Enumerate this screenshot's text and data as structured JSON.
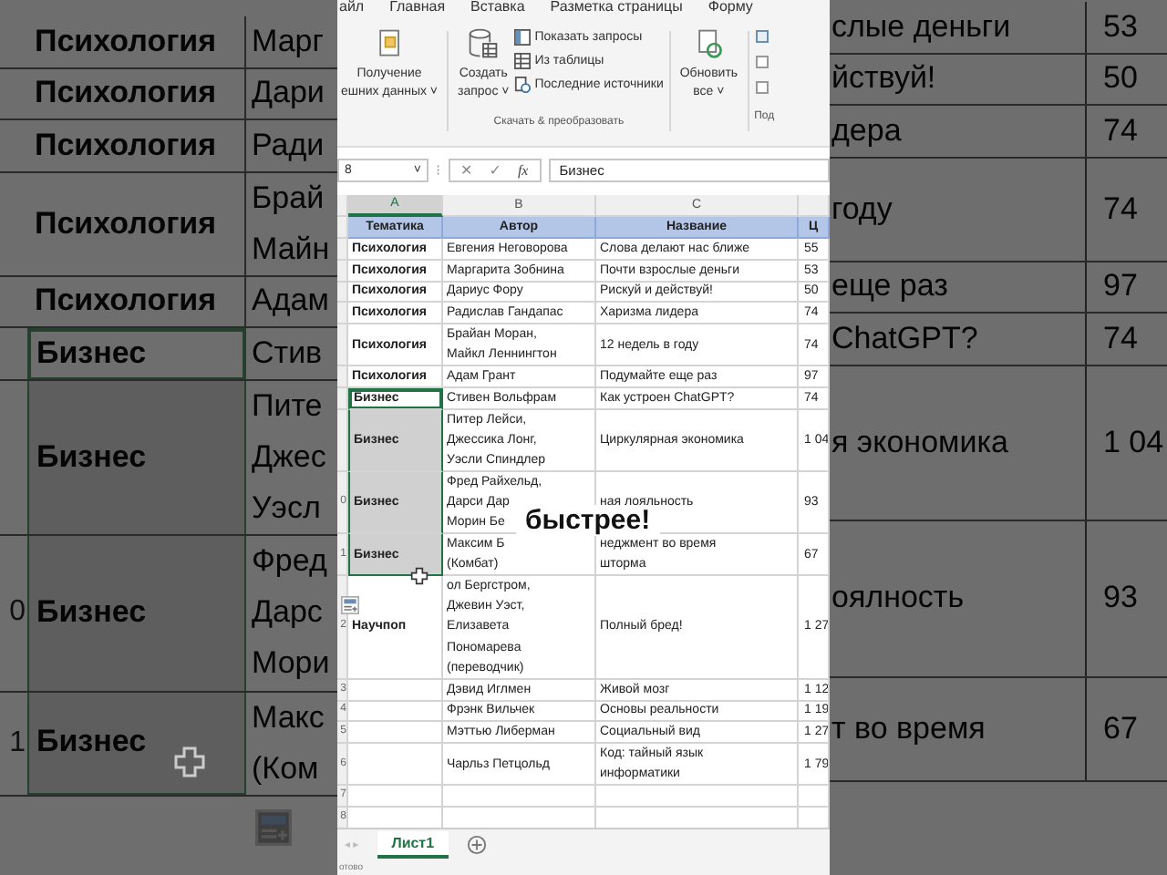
{
  "background": {
    "rows": [
      {
        "topic": "Психология",
        "author": [
          "Марг"
        ],
        "title": [
          "слые деньги"
        ],
        "price": "53",
        "selected": false,
        "active": false
      },
      {
        "topic": "Психология",
        "author": [
          "Дари"
        ],
        "title": [
          "йствуй!"
        ],
        "price": "50",
        "selected": false,
        "active": false
      },
      {
        "topic": "Психология",
        "author": [
          "Ради"
        ],
        "title": [
          "дера"
        ],
        "price": "74",
        "selected": false,
        "active": false
      },
      {
        "topic": "Психология",
        "author": [
          "Брай",
          "Майн"
        ],
        "title": [
          "году"
        ],
        "price": "74",
        "selected": false,
        "active": false
      },
      {
        "topic": "Психология",
        "author": [
          "Адам"
        ],
        "title": [
          "еще раз"
        ],
        "price": "97",
        "selected": false,
        "active": false
      },
      {
        "topic": "Бизнес",
        "author": [
          "Стив"
        ],
        "title": [
          "ChatGPT?"
        ],
        "price": "74",
        "selected": true,
        "active": true
      },
      {
        "topic": "Бизнес",
        "author": [
          "Пите",
          "Джес",
          "Уэсл"
        ],
        "title": [
          "я экономика"
        ],
        "price": "1 04",
        "selected": true,
        "active": false
      },
      {
        "number": "0",
        "topic": "Бизнес",
        "author": [
          "Фред",
          "Дарс",
          "Мори"
        ],
        "title": [
          "оялность"
        ],
        "price": "93",
        "selected": true,
        "active": false
      },
      {
        "number": "1",
        "topic": "Бизнес",
        "author": [
          "Макс",
          "(Ком"
        ],
        "title": [
          "т во время"
        ],
        "price": "67",
        "selected": true,
        "active": false
      }
    ]
  },
  "ribbon": {
    "tabs": [
      "айл",
      "Главная",
      "Вставка",
      "Разметка страницы",
      "Форму"
    ],
    "get_data": [
      "Получение",
      "ешних данных ˅"
    ],
    "create_query": [
      "Создать",
      "запрос ˅"
    ],
    "query_items": [
      "Показать запросы",
      "Из таблицы",
      "Последние источники"
    ],
    "group_label": "Скачать & преобразовать",
    "refresh": [
      "Обновить",
      "все ˅"
    ],
    "next_group_label": "Под"
  },
  "formula_bar": {
    "name_box": "8",
    "name_box_caret": "˅",
    "handle": "⁝",
    "buttons": [
      "✕",
      "✓",
      "fx"
    ],
    "value": "Бизнес"
  },
  "sheet": {
    "column_letters": [
      {
        "label": "A",
        "selected": true
      },
      {
        "label": "B",
        "selected": false
      },
      {
        "label": "C",
        "selected": false
      }
    ],
    "headers": [
      "Тематика",
      "Автор",
      "Название",
      "Ц"
    ],
    "rows": [
      {
        "topic": "Психология",
        "author": [
          "Евгения Неговорова"
        ],
        "title": [
          "Слова делают нас ближе"
        ],
        "price": "55",
        "selected": false,
        "active": false
      },
      {
        "topic": "Психология",
        "author": [
          "Маргарита Зобнина"
        ],
        "title": [
          "Почти взрослые деньги"
        ],
        "price": "53",
        "selected": false,
        "active": false
      },
      {
        "topic": "Психология",
        "author": [
          "Дариус Фору"
        ],
        "title": [
          "Рискуй и действуй!"
        ],
        "price": "50",
        "selected": false,
        "active": false
      },
      {
        "topic": "Психология",
        "author": [
          "Радислав Гандапас"
        ],
        "title": [
          "Харизма лидера"
        ],
        "price": "74",
        "selected": false,
        "active": false
      },
      {
        "topic": "Психология",
        "author": [
          "Брайан Моран,",
          "Майкл Леннингтон"
        ],
        "title": [
          "12 недель в году"
        ],
        "price": "74",
        "selected": false,
        "active": false
      },
      {
        "topic": "Психология",
        "author": [
          "Адам Грант"
        ],
        "title": [
          "Подумайте еще раз"
        ],
        "price": "97",
        "selected": false,
        "active": false
      },
      {
        "topic": "Бизнес",
        "author": [
          "Стивен Вольфрам"
        ],
        "title": [
          "Как устроен ChatGPT?"
        ],
        "price": "74",
        "selected": true,
        "active": true
      },
      {
        "topic": "Бизнес",
        "author": [
          "Питер Лейси,",
          "Джессика Лонг,",
          "Уэсли Спиндлер"
        ],
        "title": [
          "Циркулярная экономика"
        ],
        "price": "1 04",
        "selected": true,
        "active": false
      },
      {
        "number": "0",
        "topic": "Бизнес",
        "author": [
          "Фред Райхельд,",
          "Дарси Дар",
          "Морин Бе"
        ],
        "title": [
          "ная лояльность"
        ],
        "price": "93",
        "selected": true,
        "active": false
      },
      {
        "number": "1",
        "topic": "Бизнес",
        "author": [
          "Максим Б",
          "(Комбат)"
        ],
        "title": [
          "неджмент во время",
          "шторма"
        ],
        "price": "67",
        "selected": true,
        "active": false
      },
      {
        "number": "2",
        "topic": "Научпоп",
        "author": [
          "ол Бергстром,",
          "Джевин Уэст,",
          "Елизавета",
          "Пономарева",
          "(переводчик)"
        ],
        "title": [
          "Полный бред!"
        ],
        "price": "1 27",
        "selected": false,
        "active": false
      },
      {
        "number": "3",
        "author": [
          "Дэвид Иглмен"
        ],
        "title": [
          "Живой мозг"
        ],
        "price": "1 12",
        "selected": false,
        "active": false
      },
      {
        "number": "4",
        "author": [
          "Фрэнк Вильчек"
        ],
        "title": [
          "Основы реальности"
        ],
        "price": "1 19",
        "selected": false,
        "active": false
      },
      {
        "number": "5",
        "author": [
          "Мэттью Либерман"
        ],
        "title": [
          "Социальный вид"
        ],
        "price": "1 27",
        "selected": false,
        "active": false
      },
      {
        "number": "6",
        "author": [
          "Чарльз Петцольд"
        ],
        "title": [
          "Код: тайный язык",
          "информатики"
        ],
        "price": "1 79",
        "selected": false,
        "active": false
      },
      {
        "number": "7",
        "selected": false,
        "active": false
      },
      {
        "number": "8",
        "selected": false,
        "active": false
      }
    ],
    "sheet_nav": "◂ ▸",
    "sheet_tabs": [
      {
        "label": "Лист1",
        "selected": true
      }
    ],
    "status": "отово"
  },
  "caption": "быстрее!"
}
